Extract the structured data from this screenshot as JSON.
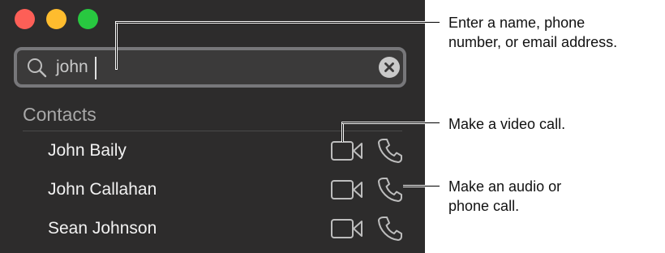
{
  "search": {
    "query": "john"
  },
  "contacts": {
    "section_title": "Contacts",
    "rows": [
      {
        "name": "John Baily"
      },
      {
        "name": "John Callahan"
      },
      {
        "name": "Sean Johnson"
      }
    ]
  },
  "callouts": {
    "search": "Enter a name, phone\nnumber, or email address.",
    "video": "Make a video call.",
    "audio": "Make an audio or\nphone call."
  },
  "colors": {
    "window_bg": "#2d2c2c",
    "close": "#fd5f57",
    "minimize": "#febc2e",
    "maximize": "#28c840"
  }
}
